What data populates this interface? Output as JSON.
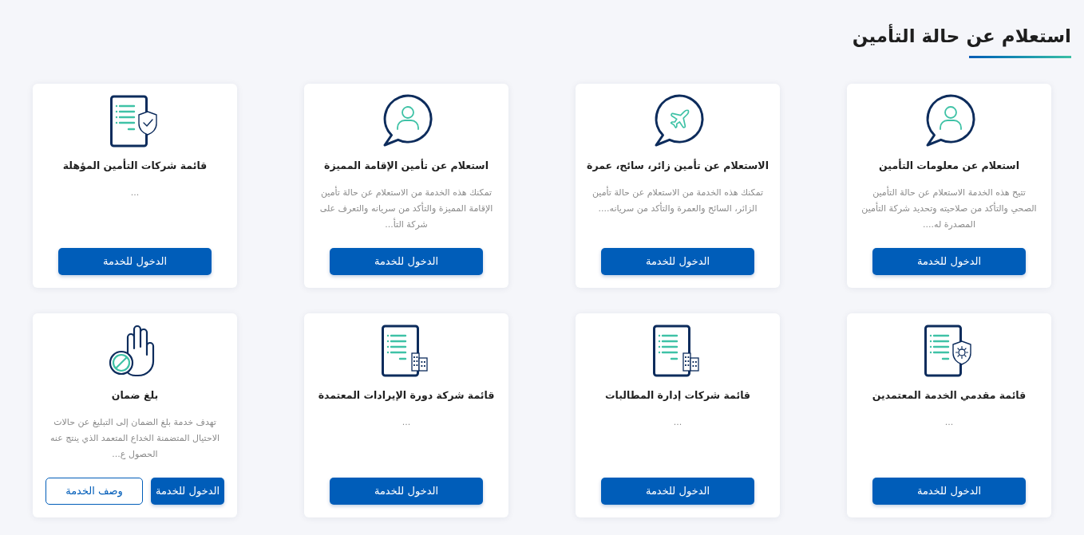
{
  "page": {
    "title": "استعلام عن حالة التأمين"
  },
  "services": [
    {
      "kind": "chat-person",
      "title": "استعلام عن معلومات التأمين",
      "description": "تتيح هذه الخدمة الاستعلام عن حالة التأمين الصحي والتأكد من صلاحيته وتحديد شركة التأمين المصدرة له....",
      "buttons": [
        {
          "kind": "primary",
          "label": "الدخول للخدمة"
        }
      ]
    },
    {
      "kind": "chat-plane",
      "title": "الاستعلام عن تأمين زائر، سائح، عمرة",
      "description": "تمكنك هذه الخدمة من الاستعلام عن حالة تأمين الزائر، السائح والعمرة والتأكد من سريانه....",
      "buttons": [
        {
          "kind": "primary",
          "label": "الدخول للخدمة"
        }
      ]
    },
    {
      "kind": "chat-person",
      "title": "استعلام عن تأمين الإقامة المميزة",
      "description": "تمكنك هذه الخدمة من الاستعلام عن حالة تأمين الإقامة المميزة والتأكد من سريانه والتعرف على شركة التأ...",
      "buttons": [
        {
          "kind": "primary",
          "label": "الدخول للخدمة"
        }
      ]
    },
    {
      "kind": "doc-shield",
      "title": "قائمة شركات التأمين المؤهلة",
      "description": "...",
      "buttons": [
        {
          "kind": "primary",
          "label": "الدخول للخدمة"
        }
      ]
    },
    {
      "kind": "doc-badge",
      "title": "قائمة مقدمي الخدمة المعتمدين",
      "description": "...",
      "buttons": [
        {
          "kind": "primary",
          "label": "الدخول للخدمة"
        }
      ]
    },
    {
      "kind": "doc-building",
      "title": "قائمة شركات إدارة المطالبات",
      "description": "...",
      "buttons": [
        {
          "kind": "primary",
          "label": "الدخول للخدمة"
        }
      ]
    },
    {
      "kind": "doc-building",
      "title": "قائمة شركة دورة الإيرادات المعتمدة",
      "description": "...",
      "buttons": [
        {
          "kind": "primary",
          "label": "الدخول للخدمة"
        }
      ]
    },
    {
      "kind": "hand-stop",
      "title": "بلغ ضمان",
      "description": "تهدف خدمة بلغ الضمان إلى التبليغ عن حالات الاحتيال المتضمنة الخداع المتعمد الذي ينتج عنه الحصول ع...",
      "buttons": [
        {
          "kind": "primary",
          "label": "الدخول للخدمة"
        },
        {
          "kind": "outline",
          "label": "وصف الخدمة"
        }
      ]
    }
  ]
}
